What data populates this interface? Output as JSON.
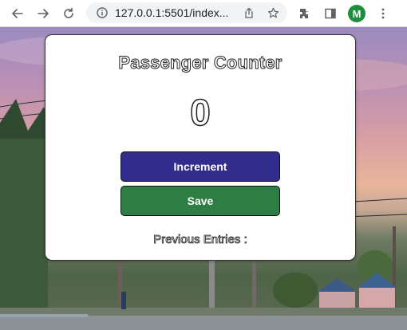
{
  "browser": {
    "url": "127.0.0.1:5501/index...",
    "profile_initial": "M",
    "icons": [
      "back-icon",
      "forward-icon",
      "reload-icon",
      "info-icon",
      "share-icon",
      "star-icon",
      "extensions-icon",
      "side-panel-icon",
      "menu-icon"
    ]
  },
  "app": {
    "title": "Passenger Counter",
    "count": "0",
    "increment_label": "Increment",
    "save_label": "Save",
    "previous_label": "Previous Entries :"
  },
  "colors": {
    "increment_button": "#312d8e",
    "save_button": "#2e7d45",
    "avatar": "#1e8e3e"
  }
}
